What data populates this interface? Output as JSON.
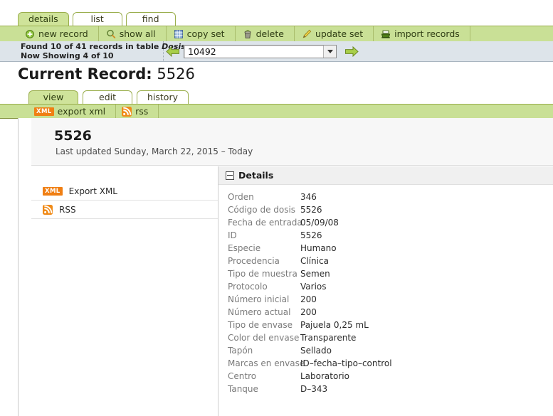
{
  "top_tabs": [
    {
      "label": "details",
      "active": true
    },
    {
      "label": "list",
      "active": false
    },
    {
      "label": "find",
      "active": false
    }
  ],
  "actions": [
    {
      "label": "new record",
      "icon": "plus-circle-icon"
    },
    {
      "label": "show all",
      "icon": "magnifier-icon"
    },
    {
      "label": "copy set",
      "icon": "grid-copy-icon"
    },
    {
      "label": "delete",
      "icon": "trash-icon"
    },
    {
      "label": "update set",
      "icon": "pencil-icon"
    },
    {
      "label": "import records",
      "icon": "import-tray-icon"
    }
  ],
  "status": {
    "found_prefix": "Found 10 of 41 records in table ",
    "found_table": "Dosis",
    "showing": "Now Showing 4 of 10",
    "prev_icon": "left-arrow-icon",
    "next_icon": "right-arrow-icon"
  },
  "record_select": {
    "value": "10492",
    "caret_icon": "chevron-down-icon"
  },
  "page_title": {
    "label": "Current Record:",
    "record_id": "5526"
  },
  "sub_tabs": [
    {
      "label": "view",
      "active": true
    },
    {
      "label": "edit",
      "active": false
    },
    {
      "label": "history",
      "active": false
    }
  ],
  "sub_actions": [
    {
      "label": "export xml",
      "icon": "xml-badge-icon"
    },
    {
      "label": "rss",
      "icon": "rss-icon"
    }
  ],
  "record_header": {
    "id": "5526",
    "last_updated": "Last updated Sunday, March 22, 2015 – Today"
  },
  "sidebar": {
    "items": [
      {
        "label": "Export XML",
        "icon": "xml-badge-icon",
        "badge_text": "XML"
      },
      {
        "label": "RSS",
        "icon": "rss-icon"
      }
    ]
  },
  "details": {
    "title": "Details",
    "collapse_icon": "collapse-minus-icon",
    "fields": [
      {
        "name": "Orden",
        "value": "346"
      },
      {
        "name": "Código de dosis",
        "value": "5526"
      },
      {
        "name": "Fecha de entrada",
        "value": "05/09/08"
      },
      {
        "name": "ID",
        "value": "5526"
      },
      {
        "name": "Especie",
        "value": "Humano"
      },
      {
        "name": "Procedencia",
        "value": "Clínica"
      },
      {
        "name": "Tipo de muestra",
        "value": "Semen"
      },
      {
        "name": "Protocolo",
        "value": "Varios"
      },
      {
        "name": "Número inicial",
        "value": "200"
      },
      {
        "name": "Número actual",
        "value": "200"
      },
      {
        "name": "Tipo de envase",
        "value": "Pajuela 0,25 mL"
      },
      {
        "name": "Color del envase",
        "value": "Transparente"
      },
      {
        "name": "Tapón",
        "value": "Sellado"
      },
      {
        "name": "Marcas en envase",
        "value": "ID–fecha–tipo–control"
      },
      {
        "name": "Centro",
        "value": "Laboratorio"
      },
      {
        "name": "Tanque",
        "value": "D–343"
      }
    ]
  },
  "colors": {
    "green_bar": "#c9e096",
    "green_border": "#9aae4c",
    "status_bar": "#dde4ea",
    "orange": "#f07f13"
  }
}
